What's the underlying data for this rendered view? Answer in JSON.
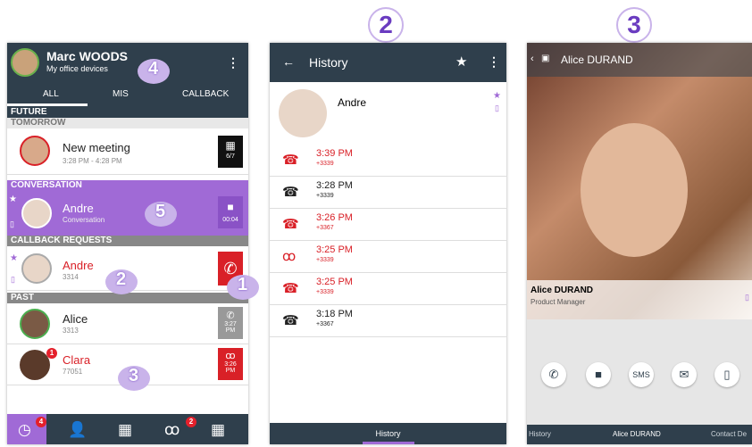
{
  "step_numbers": [
    "2",
    "3"
  ],
  "hand_numbers": [
    "4",
    "5",
    "2",
    "1",
    "3"
  ],
  "phone1": {
    "user_name": "Marc WOODS",
    "user_sub": "My office devices",
    "menu_icon": "⋮",
    "tabs": [
      "ALL",
      "MIS",
      "CALLBACK"
    ],
    "future": "FUTURE",
    "tomorrow": "TOMORROW",
    "meeting": {
      "title": "New meeting",
      "time": "3:28 PM - 4:28 PM",
      "badge": "6/7"
    },
    "conversation": "CONVERSATION",
    "conv": {
      "name": "Andre",
      "sub": "Conversation",
      "time": "00:04"
    },
    "callback_requests": "CALLBACK REQUESTS",
    "callback": {
      "name": "Andre",
      "num": "3314"
    },
    "past": "PAST",
    "alice": {
      "name": "Alice",
      "num": "3313",
      "time": "3:27",
      "ampm": "PM"
    },
    "clara": {
      "name": "Clara",
      "num": "77051",
      "time": "3:26",
      "ampm": "PM",
      "badge": "1"
    },
    "bottom_badges": [
      "4",
      "2"
    ]
  },
  "phone2": {
    "title": "History",
    "contact": "Andre",
    "rows": [
      {
        "time": "3:39 PM",
        "num": "+3339",
        "color": "#d92027",
        "icon": "☎"
      },
      {
        "time": "3:28 PM",
        "num": "+3339",
        "color": "#222",
        "icon": "☎"
      },
      {
        "time": "3:26 PM",
        "num": "+3367",
        "color": "#d92027",
        "icon": "☎"
      },
      {
        "time": "3:25 PM",
        "num": "+3339",
        "color": "#d92027",
        "icon": "ꝏ"
      },
      {
        "time": "3:25 PM",
        "num": "+3339",
        "color": "#d92027",
        "icon": "☎"
      },
      {
        "time": "3:18 PM",
        "num": "+3367",
        "color": "#222",
        "icon": "☎"
      }
    ],
    "footer": "History"
  },
  "phone3": {
    "title": "Alice DURAND",
    "name": "Alice DURAND",
    "role": "Product Manager",
    "bottom": [
      "History",
      "Alice DURAND",
      "Contact De"
    ]
  },
  "colors": {
    "dark": "#2f3f4c",
    "purple": "#a06ad6",
    "red": "#d92027",
    "accent": "#6a3cc0"
  }
}
